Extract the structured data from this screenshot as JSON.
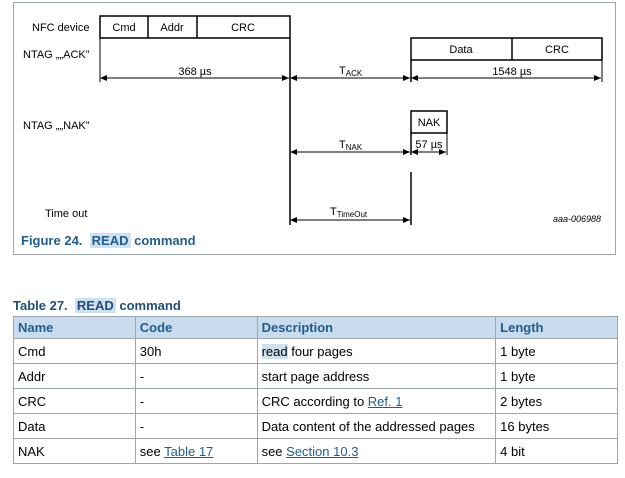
{
  "figure": {
    "caption_prefix": "Figure 24.",
    "caption_highlight": "READ",
    "caption_rest": " command",
    "nfc_label": "NFC device",
    "ack_label": "NTAG „„ACK”",
    "nak_label": "NTAG „„NAK”",
    "timeout_label": "Time out",
    "cmd_fields": [
      "Cmd",
      "Addr",
      "CRC"
    ],
    "resp_fields": [
      "Data",
      "CRC"
    ],
    "nak_field": "NAK",
    "t368": "368 µs",
    "t1548": "1548 µs",
    "t57": "57 µs",
    "tack_main": "T",
    "tack_sub": "ACK",
    "tnak_main": "T",
    "tnak_sub": "NAK",
    "tto_main": "T",
    "tto_sub": "TimeOut",
    "code": "aaa-006988"
  },
  "table": {
    "title_prefix": "Table 27.",
    "title_highlight": "READ",
    "title_rest": " command",
    "headers": [
      "Name",
      "Code",
      "Description",
      "Length"
    ],
    "rows": [
      {
        "name": "Cmd",
        "code": "30h",
        "desc_hl": "read",
        "desc": " four pages",
        "length": "1 byte"
      },
      {
        "name": "Addr",
        "code": "-",
        "desc": "start page address",
        "length": "1 byte"
      },
      {
        "name": "CRC",
        "code": "-",
        "desc": "CRC according to ",
        "desc_link": "Ref. 1",
        "length": "2 bytes"
      },
      {
        "name": "Data",
        "code": "-",
        "desc": "Data content of the addressed pages",
        "length": "16 bytes"
      },
      {
        "name": "NAK",
        "code": "see ",
        "code_link": "Table 17",
        "desc": "see ",
        "desc_link": "Section 10.3",
        "length": "4 bit"
      }
    ]
  }
}
